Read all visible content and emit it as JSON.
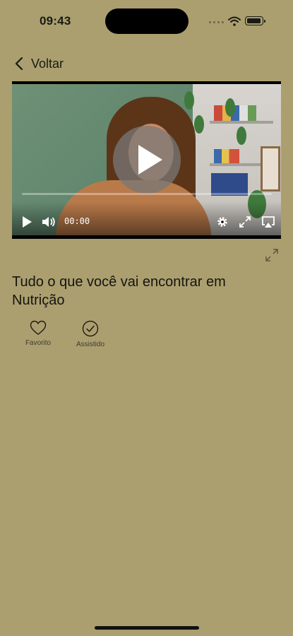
{
  "status_bar": {
    "time": "09:43",
    "icons": [
      "signal-dots-icon",
      "wifi-icon",
      "battery-icon"
    ]
  },
  "navigation": {
    "back_label": "Voltar",
    "back_icon": "chevron-left-icon"
  },
  "video_player": {
    "time_code": "00:00",
    "controls": [
      "play-icon",
      "volume-icon",
      "settings-icon",
      "fullscreen-icon",
      "airplay-icon"
    ],
    "overlay_icon": "play-icon"
  },
  "content": {
    "title": "Tudo o que você vai encontrar em Nutrição",
    "actions": [
      {
        "label": "Favorito",
        "icon": "heart-icon"
      },
      {
        "label": "Assistido",
        "icon": "check-circle-icon"
      }
    ]
  },
  "colors": {
    "background": "#ab9f70",
    "text": "#16140e"
  }
}
